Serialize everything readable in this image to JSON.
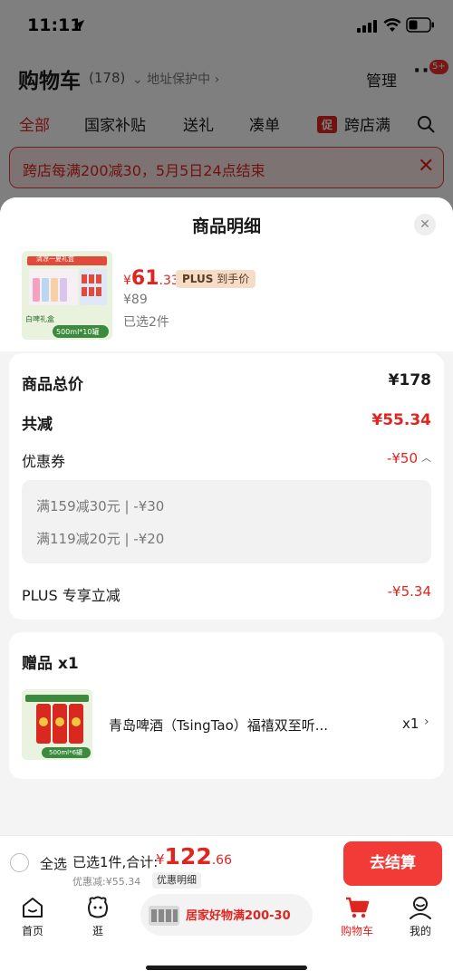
{
  "status_bar": {
    "time": "11:11"
  },
  "header": {
    "title": "购物车",
    "count": "(178)",
    "address": "⌄ 地址保护中 ›",
    "manage": "管理",
    "more": "···",
    "badge": "5+"
  },
  "tabs": [
    {
      "label": "全部",
      "active": true
    },
    {
      "label": "国家补贴"
    },
    {
      "label": "送礼"
    },
    {
      "label": "凑单"
    },
    {
      "label": "跨店满",
      "tag": "促"
    }
  ],
  "promo_banner": {
    "text": "跨店每满200减30，5月5日24点结束"
  },
  "sheet": {
    "title": "商品明细",
    "product": {
      "price_yen": "¥",
      "price_int": "61",
      "price_dec": ".33",
      "plus_badge_plus": "PLUS",
      "plus_badge_text": "到手价",
      "original_price": "¥89",
      "selected": "已选2件",
      "img_text_top": "清凉一夏礼盒",
      "img_text_bottom": "500ml*10罐",
      "img_text_left": "白啤礼盒"
    },
    "summary": {
      "total_label": "商品总价",
      "total_value": "¥178",
      "reduce_label": "共减",
      "reduce_value": "¥55.34",
      "coupon_label": "优惠券",
      "coupon_value": "-¥50",
      "coupon_lines": [
        "满159减30元 | -¥30",
        "满119减20元 | -¥20"
      ],
      "plus_label": "PLUS 专享立减",
      "plus_value": "-¥5.34"
    },
    "gift": {
      "title": "赠品 x1",
      "name": "青岛啤酒（TsingTao）福禧双至听...",
      "qty": "x1",
      "img_text": "500ml*6罐"
    }
  },
  "checkout": {
    "select_all": "全选",
    "selected_summary": "已选1件,合计:",
    "total_yen": "¥",
    "total_int": "122",
    "total_dec": ".66",
    "discount": "优惠减:¥55.34",
    "detail_button": "优惠明细",
    "pay_button": "去结算"
  },
  "tabbar": {
    "home": "首页",
    "browse": "逛",
    "promo": "居家好物满200-30",
    "cart": "购物车",
    "me": "我的"
  },
  "colors": {
    "accent": "#e0241f",
    "pay_button": "#f23b37",
    "plus_badge": "#f4dcc6"
  }
}
